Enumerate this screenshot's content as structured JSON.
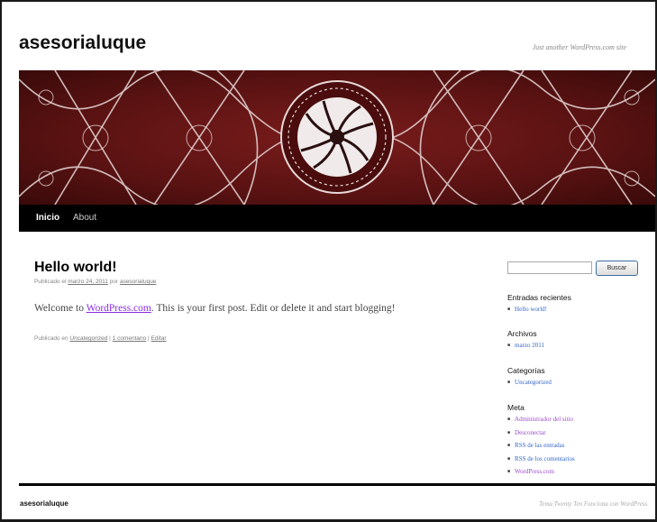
{
  "site": {
    "title": "asesorialuque",
    "description": "Just another WordPress.com site"
  },
  "nav": {
    "items": [
      {
        "label": "Inicio",
        "current": true
      },
      {
        "label": "About",
        "current": false
      }
    ]
  },
  "post": {
    "title": "Hello world!",
    "meta_prefix": "Publicado el",
    "date": "marzo 24, 2011",
    "meta_by": "por",
    "author": "asesorialuque",
    "content_before": "Welcome to",
    "content_link": "WordPress.com",
    "content_after": ". This is your first post. Edit or delete it and start blogging!",
    "util_prefix": "Publicado en",
    "category": "Uncategorized",
    "sep1": "|",
    "comments": "1 comentario",
    "sep2": "|",
    "edit": "Editar"
  },
  "sidebar": {
    "search_placeholder": "",
    "search_button": "Buscar",
    "recent_title": "Entradas recientes",
    "recent_items": [
      "Hello world!"
    ],
    "archives_title": "Archivos",
    "archives_items": [
      "marzo 2011"
    ],
    "categories_title": "Categorías",
    "categories_items": [
      "Uncategorized"
    ],
    "meta_title": "Meta",
    "meta_items": [
      "Administrador del sitio",
      "Desconectar",
      "RSS de las entradas",
      "RSS de los comentarios",
      "WordPress.com"
    ]
  },
  "footer": {
    "title": "asesorialuque",
    "credit": "Tema Twenty Ten Funciona con WordPress."
  },
  "colors": {
    "link": "#3366cc",
    "visited": "#9b4dca",
    "nav_bg": "#000000",
    "header_bg": "#5a1010"
  }
}
